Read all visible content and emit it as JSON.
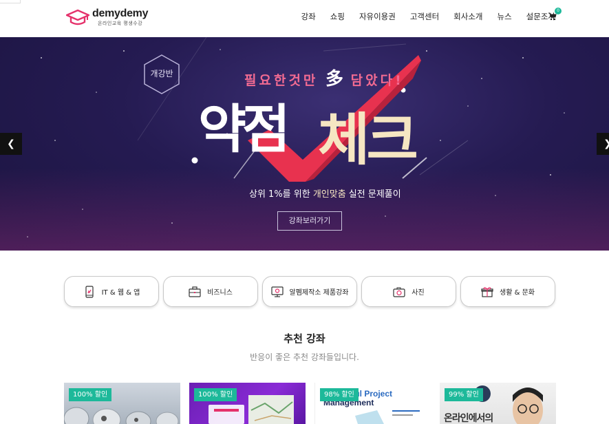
{
  "header": {
    "logo_name": "demydemy",
    "logo_sub": "온라인교육 평생수강",
    "nav": [
      "강좌",
      "쇼핑",
      "자유이용권",
      "고객센터",
      "회사소개",
      "뉴스",
      "설문조사"
    ],
    "cart_count": "0",
    "cart_icon": "cart-icon"
  },
  "hero": {
    "badge": "개강반",
    "top_line_a": "필요한것만",
    "top_line_big": "多",
    "top_line_b": "담았다!",
    "title_a": "약점",
    "title_b": "체크",
    "sub_a": "상위 1%를 위한 ",
    "sub_highlight": "개인맞춤",
    "sub_b": " 실전 문제풀이",
    "button": "강좌보러가기",
    "prev_icon": "chevron-left-icon",
    "next_icon": "chevron-right-icon",
    "colors": {
      "bg": "#251b52",
      "accent": "#f36b92",
      "check": "#e8324f",
      "title_b": "#f6e6c2"
    }
  },
  "categories": [
    {
      "label": "IT & 웹 & 앱",
      "icon": "mobile-icon"
    },
    {
      "label": "비즈니스",
      "icon": "briefcase-icon"
    },
    {
      "label": "알펨제작소 제품강좌",
      "icon": "monitor-icon"
    },
    {
      "label": "사진",
      "icon": "camera-icon"
    },
    {
      "label": "생활 & 문화",
      "icon": "gift-icon"
    }
  ],
  "recommended": {
    "title": "추천 강좌",
    "subtitle": "반응이 좋은 추천 강좌들입니다.",
    "cards": [
      {
        "badge": "100% 할인"
      },
      {
        "badge": "100% 할인"
      },
      {
        "badge": "98% 할인",
        "text_a": "ssful Project",
        "text_b": "Management"
      },
      {
        "badge": "99% 할인",
        "text": "온라인에서의"
      }
    ]
  },
  "colors": {
    "accent_green": "#1db99a",
    "logo_pink": "#e5316b"
  }
}
